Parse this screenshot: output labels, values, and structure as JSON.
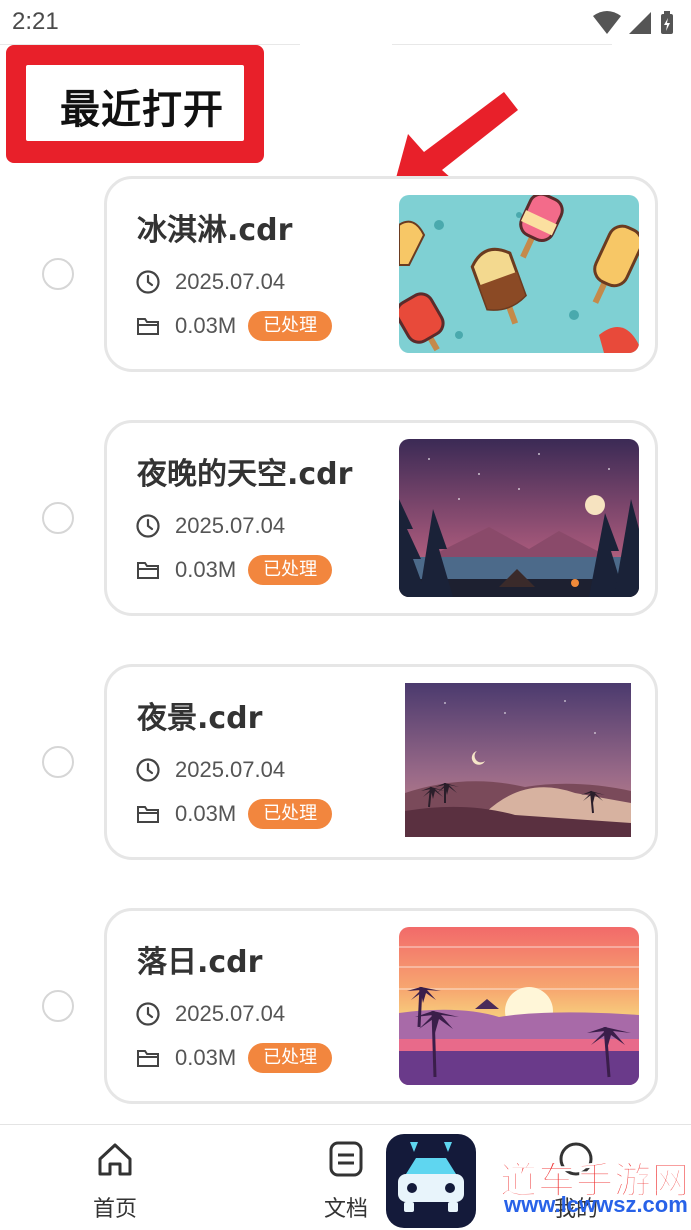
{
  "status_bar": {
    "time": "2:21"
  },
  "header": {
    "title": "最近打开"
  },
  "files": [
    {
      "name": "冰淇淋.cdr",
      "date": "2025.07.04",
      "size": "0.03M",
      "status": "已处理",
      "thumb": "popsicles"
    },
    {
      "name": "夜晚的天空.cdr",
      "date": "2025.07.04",
      "size": "0.03M",
      "status": "已处理",
      "thumb": "night-camp"
    },
    {
      "name": "夜景.cdr",
      "date": "2025.07.04",
      "size": "0.03M",
      "status": "已处理",
      "thumb": "desert-night"
    },
    {
      "name": "落日.cdr",
      "date": "2025.07.04",
      "size": "0.03M",
      "status": "已处理",
      "thumb": "tropical-sunset"
    }
  ],
  "bottom_nav": [
    {
      "label": "首页",
      "icon": "home-icon",
      "active": true
    },
    {
      "label": "文档",
      "icon": "document-icon",
      "active": false
    },
    {
      "label": "我的",
      "icon": "profile-icon",
      "active": false
    }
  ],
  "watermark": {
    "text": "道车手游网",
    "url": "www.lcwwsz.com"
  },
  "colors": {
    "accent": "#f2863e",
    "highlight": "#e8202a",
    "card_border": "#e6e6e6"
  }
}
